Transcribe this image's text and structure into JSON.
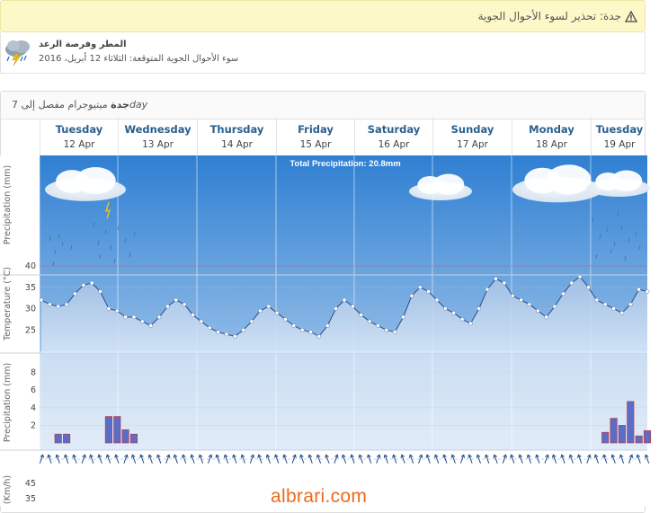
{
  "alert": {
    "text": "جدة: تحذير لسوء الأحوال الجوية",
    "icon": "warning-triangle-icon"
  },
  "warning": {
    "title": "المطر وفرصة الرعد",
    "description": "سوء الأحوال الجوية المتوقعة: الثلاثاء 12 أبريل، 2016",
    "icon": "thunderstorm-icon"
  },
  "meteogram": {
    "title_city": "جدة",
    "title_text": "ميتيوجرام مفصل إلى 7",
    "title_suffix": "day",
    "days": [
      {
        "name": "Tuesday",
        "date": "12 Apr"
      },
      {
        "name": "Wednesday",
        "date": "13 Apr"
      },
      {
        "name": "Thursday",
        "date": "14 Apr"
      },
      {
        "name": "Friday",
        "date": "15 Apr"
      },
      {
        "name": "Saturday",
        "date": "16 Apr"
      },
      {
        "name": "Sunday",
        "date": "17 Apr"
      },
      {
        "name": "Monday",
        "date": "18 Apr"
      },
      {
        "name": "Tuesday",
        "date": "19 Apr"
      }
    ],
    "total_precipitation": "Total Precipitation: 20.8mm",
    "axes": {
      "precip_top": "Precipitation (mm)",
      "temperature": "Temperature (°C)",
      "precip_bottom": "Precipitation (mm)",
      "wind": "(Km/h)"
    },
    "temp_ticks": [
      "40",
      "35",
      "30",
      "25"
    ],
    "precip_ticks": [
      "8",
      "6",
      "4",
      "2"
    ],
    "wind_ticks": [
      "45",
      "35"
    ]
  },
  "chart_data": {
    "type": "line",
    "x_unit": "3-hour steps from Tuesday 12 Apr",
    "temperature": {
      "name": "Temperature",
      "ylim": [
        20,
        40
      ],
      "values": [
        32,
        31,
        30.5,
        31,
        33.5,
        35.5,
        36,
        34,
        30,
        29.5,
        28,
        28,
        27,
        26,
        28,
        30.5,
        32,
        31,
        28.5,
        27,
        25.5,
        24.5,
        24,
        23.5,
        25,
        27,
        29.5,
        30.5,
        29,
        27.5,
        26,
        25,
        24.5,
        23.5,
        26,
        30,
        32,
        30.5,
        28.5,
        27,
        26,
        25,
        24.5,
        28,
        33,
        35,
        34,
        32,
        30,
        29,
        27.5,
        26.5,
        30,
        34.5,
        37,
        36,
        33,
        32,
        31,
        29.5,
        28,
        30.5,
        33.5,
        36,
        37.5,
        35,
        32,
        31,
        30,
        29,
        31,
        34.5,
        34
      ]
    },
    "precipitation": {
      "name": "Precipitation",
      "ylim": [
        0,
        10
      ],
      "values": [
        0,
        0,
        1,
        1,
        0,
        0,
        0,
        0,
        3,
        3,
        1.5,
        1,
        0,
        0,
        0,
        0,
        0,
        0,
        0,
        0,
        0,
        0,
        0,
        0,
        0,
        0,
        0,
        0,
        0,
        0,
        0,
        0,
        0,
        0,
        0,
        0,
        0,
        0,
        0,
        0,
        0,
        0,
        0,
        0,
        0,
        0,
        0,
        0,
        0,
        0,
        0,
        0,
        0,
        0,
        0,
        0,
        0,
        0,
        0,
        0,
        0,
        0,
        0,
        0,
        0,
        0,
        0,
        1.2,
        2.8,
        2,
        4.7,
        0.8,
        1.4
      ]
    },
    "colors": {
      "sky_top": "#2f7fd2",
      "sky_bottom": "#e8f1fb",
      "temp_line": "#2a4d8a",
      "bar": "#5b6dc7",
      "bar_edge": "#c0393b",
      "wind_arrow": "#1f4c8a"
    }
  }
}
